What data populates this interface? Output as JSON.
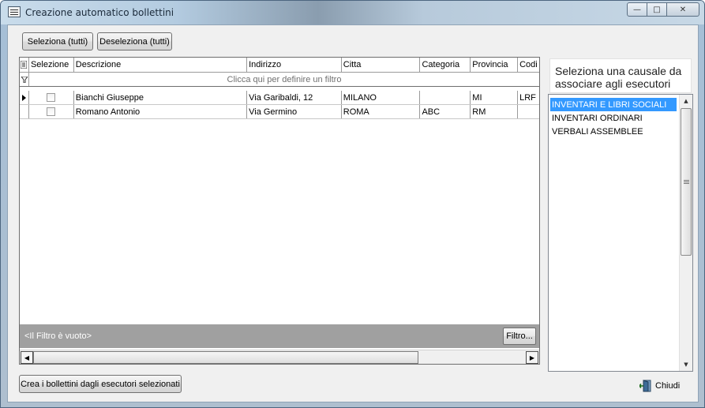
{
  "window": {
    "title": "Creazione automatico bollettini",
    "controls": {
      "minimize": "—",
      "maximize": "□",
      "close": "✕"
    }
  },
  "toolbar": {
    "select_all": "Seleziona (tutti)",
    "deselect_all": "Deseleziona (tutti)"
  },
  "grid": {
    "columns": [
      "Selezione",
      "Descrizione",
      "Indirizzo",
      "Citta",
      "Categoria",
      "Provincia",
      "Codi"
    ],
    "filter_hint": "Clicca qui per definire un filtro",
    "rows": [
      {
        "descrizione": "Bianchi Giuseppe",
        "indirizzo": "Via Garibaldi, 12",
        "citta": "MILANO",
        "categoria": "",
        "provincia": "MI",
        "codice": "LRF",
        "selected": false,
        "current": true
      },
      {
        "descrizione": "Romano Antonio",
        "indirizzo": "Via Germino",
        "citta": "ROMA",
        "categoria": "ABC",
        "provincia": "RM",
        "codice": "",
        "selected": false,
        "current": false
      }
    ],
    "status_text": "<Il Filtro è vuoto>",
    "filter_button": "Filtro..."
  },
  "right_panel": {
    "label": "Seleziona una causale da associare agli esecutori",
    "items": [
      "INVENTARI E LIBRI SOCIALI",
      "INVENTARI ORDINARI",
      "VERBALI ASSEMBLEE"
    ],
    "selected_index": 0
  },
  "footer": {
    "create_button": "Crea i bollettini dagli esecutori selezionati",
    "close_label": "Chiudi"
  },
  "colors": {
    "selection": "#3399ff",
    "status_bar": "#a0a0a0"
  }
}
